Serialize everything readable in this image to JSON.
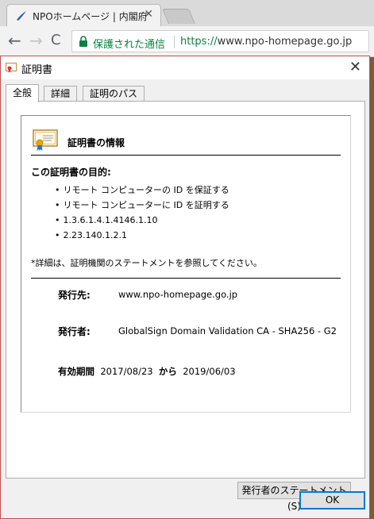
{
  "browser": {
    "tab_title": "NPOホームページ | 内閣府",
    "tab_close": "✕",
    "back": "←",
    "forward": "→",
    "reload": "C",
    "secure_label": "保護された通信",
    "url_scheme": "https://",
    "url_host": "www.npo-homepage.go.jp",
    "colors": {
      "secure_green": "#0b8043",
      "tabstrip": "#dadada"
    }
  },
  "dialog": {
    "title": "証明書",
    "close": "✕",
    "tabs": [
      {
        "label": "全般",
        "active": true
      },
      {
        "label": "詳細",
        "active": false
      },
      {
        "label": "証明のパス",
        "active": false
      }
    ],
    "info_title": "証明書の情報",
    "purpose_title": "この証明書の目的:",
    "purposes": [
      "リモート コンピューターの ID を保証する",
      "リモート コンピューターに ID を証明する",
      "1.3.6.1.4.1.4146.1.10",
      "2.23.140.1.2.1"
    ],
    "note": "*詳細は、証明機関のステートメントを参照してください。",
    "issued_to_label": "発行先:",
    "issued_to_value": "www.npo-homepage.go.jp",
    "issued_by_label": "発行者:",
    "issued_by_value": "GlobalSign Domain Validation CA - SHA256 - G2",
    "validity_label": "有効期間",
    "valid_from": "2017/08/23",
    "validity_from_word": "から",
    "valid_to": "2019/06/03",
    "statement_button": "発行者のステートメント(S)",
    "ok_button": "OK"
  }
}
